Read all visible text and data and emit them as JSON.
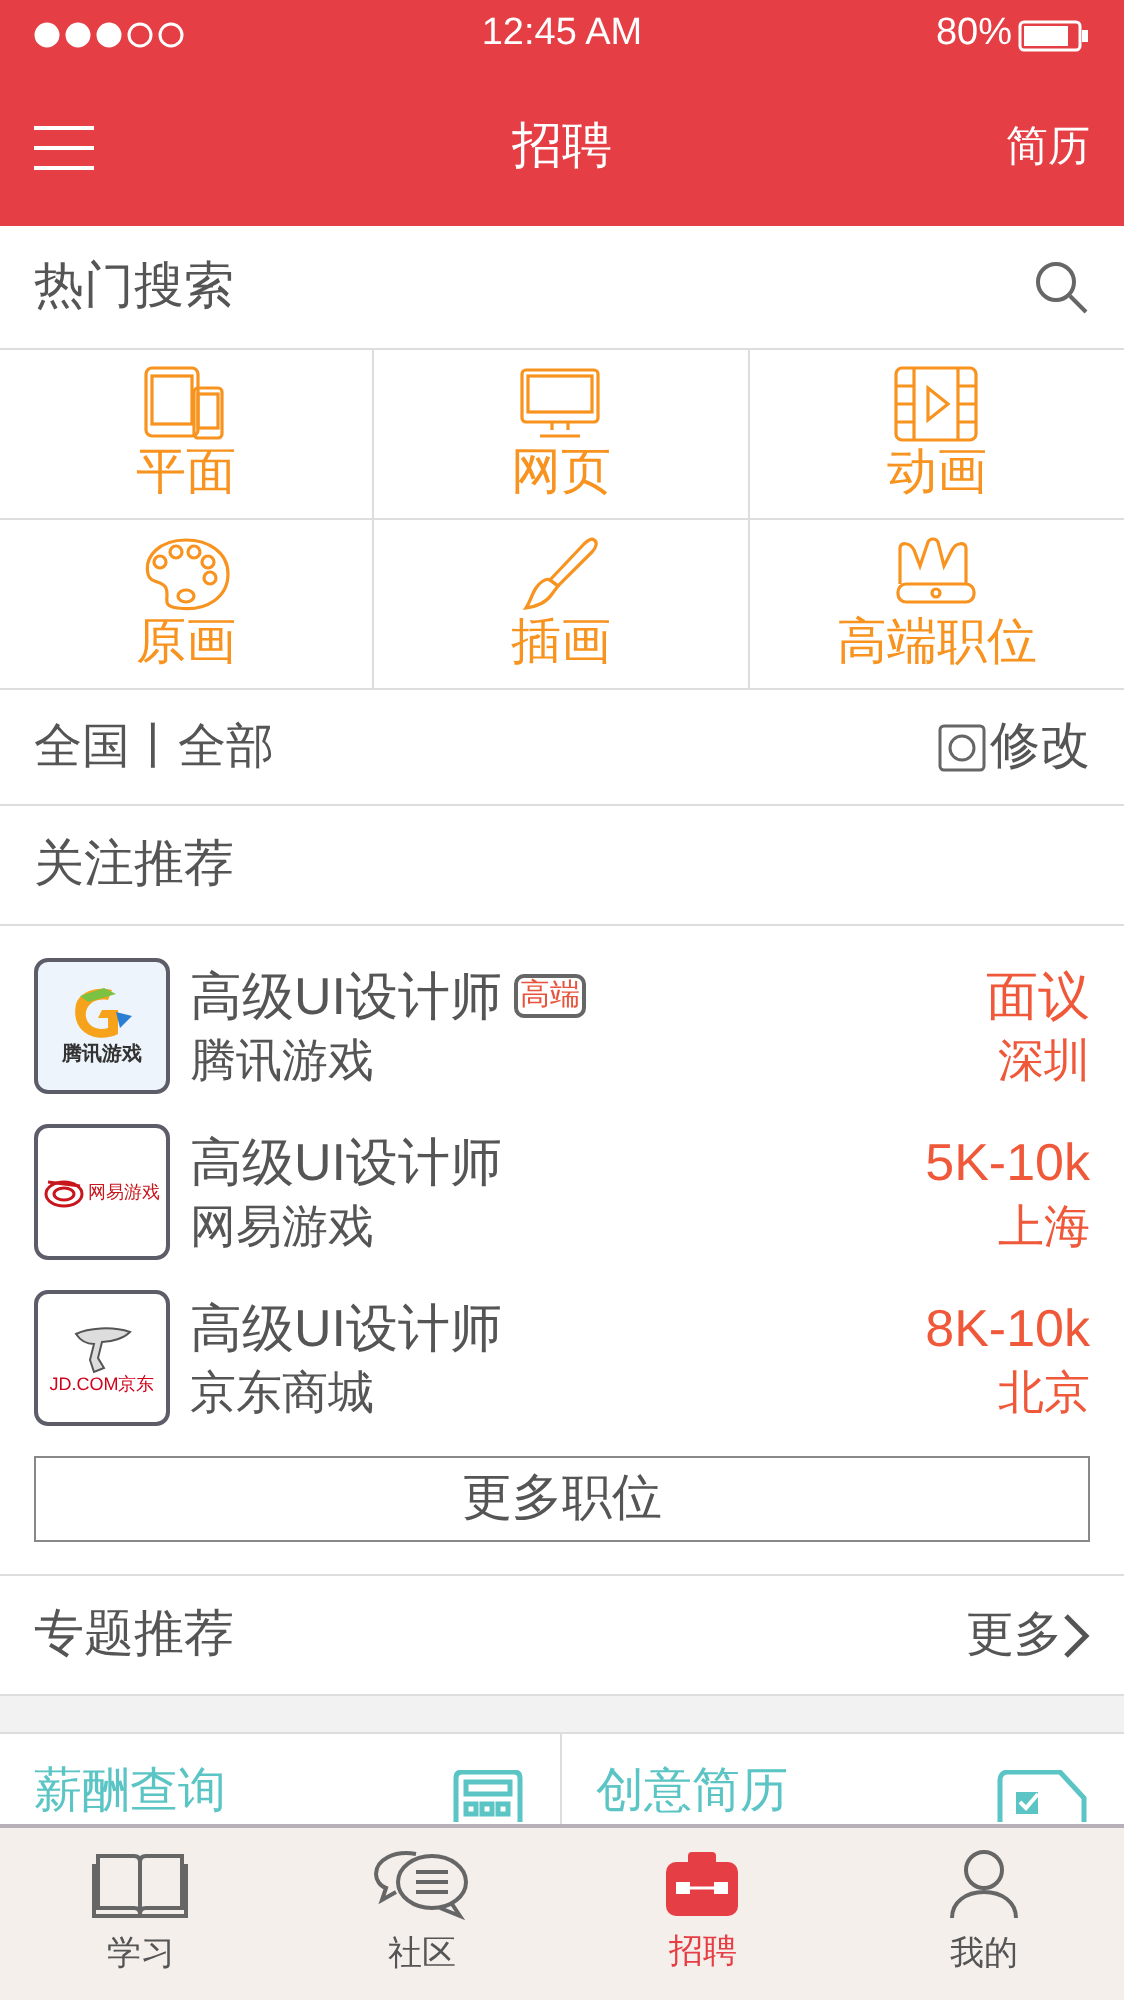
{
  "status_bar": {
    "time": "12:45 AM",
    "battery": "80%"
  },
  "header": {
    "title": "招聘",
    "right_link": "简历"
  },
  "hot_search": {
    "title": "热门搜索"
  },
  "categories": [
    {
      "kind": "devices",
      "label": "平面"
    },
    {
      "kind": "monitor",
      "label": "网页"
    },
    {
      "kind": "film",
      "label": "动画"
    },
    {
      "kind": "palette",
      "label": "原画"
    },
    {
      "kind": "brush",
      "label": "插画"
    },
    {
      "kind": "crown",
      "label": "高端职位"
    }
  ],
  "region": {
    "value": "全国丨全部",
    "edit": "修改"
  },
  "recommend": {
    "title": "关注推荐"
  },
  "jobs": [
    {
      "kind": "tencent",
      "logo_text": "腾讯游戏",
      "title": "高级UI设计师",
      "tag": "高端",
      "company": "腾讯游戏",
      "salary": "面议",
      "city": "深圳"
    },
    {
      "kind": "netease",
      "logo_text": "网易游戏",
      "title": "高级UI设计师",
      "company": "网易游戏",
      "salary": "5K-10k",
      "city": "上海"
    },
    {
      "kind": "jd",
      "logo_text": "JD.COM京东",
      "title": "高级UI设计师",
      "company": "京东商城",
      "salary": "8K-10k",
      "city": "北京"
    }
  ],
  "more_jobs": "更多职位",
  "topics": {
    "title": "专题推荐",
    "more": "更多"
  },
  "topic_cards": [
    {
      "kind": "calculator",
      "label": "薪酬查询"
    },
    {
      "kind": "resume",
      "label": "创意简历"
    }
  ],
  "tabs": [
    {
      "kind": "book",
      "label": "学习",
      "selected": false
    },
    {
      "kind": "chat",
      "label": "社区",
      "selected": false
    },
    {
      "kind": "toolbox",
      "label": "招聘",
      "selected": true
    },
    {
      "kind": "person",
      "label": "我的",
      "selected": false
    }
  ]
}
